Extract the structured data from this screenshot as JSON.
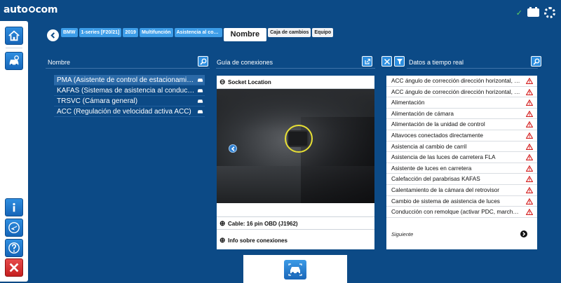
{
  "app": {
    "logo_left": "auto",
    "logo_right": "com"
  },
  "status": {
    "connected_icon": "check-icon",
    "battery_icon": "battery-icon",
    "settings_icon": "gear-icon"
  },
  "toolbar": {
    "top": [
      {
        "name": "home-icon"
      },
      {
        "name": "vehicle-settings-icon"
      }
    ],
    "bottom": [
      {
        "name": "info-icon"
      },
      {
        "name": "plane-icon"
      },
      {
        "name": "help-icon"
      },
      {
        "name": "close-icon"
      }
    ]
  },
  "breadcrumbs": [
    "BMW",
    "1-series [F20/21]",
    "2019",
    "Multifunción",
    "Asistencia al conductor"
  ],
  "breadcrumb_active": "Nombre",
  "breadcrumb_after": [
    "Caja de cambios",
    "Equipo"
  ],
  "nombre": {
    "header": "Nombre",
    "items": [
      "PMA (Asistente de control de estacionamiento)",
      "KAFAS (Sistemas de asistencia al conductor con cámara)",
      "TRSVC (Cámara general)",
      "ACC (Regulación de velocidad activa ACC)"
    ]
  },
  "guia": {
    "header": "Guía de conexiones",
    "socket_title": "Socket Location",
    "cable_label": "Cable: 16 pin OBD (J1962)",
    "info_label": "Info sobre conexiones",
    "collapse_symbol": "⊖",
    "expand_symbol": "⊕"
  },
  "datos": {
    "header": "Datos a tiempo real",
    "items": [
      "ACC ángulo de corrección dirección horizontal, cámara",
      "ACC ángulo de corrección dirección horizontal, radar",
      "Alimentación",
      "Alimentación de cámara",
      "Alimentación de la unidad de control",
      "Altavoces conectados directamente",
      "Asistencia al cambio de carril",
      "Asistencia de las luces de carretera FLA",
      "Asistente de luces en carretera",
      "Calefacción del parabrisas KAFAS",
      "Calentamiento de la cámara del retrovisor",
      "Cambio de sistema de asistencia de luces",
      "Conducción con remolque (activar PDC, marcha atrás)"
    ],
    "next_label": "Siguiente"
  },
  "colors": {
    "background": "#0c4a86",
    "accent": "#2e8fe0",
    "warning": "#d42020",
    "highlight_circle": "#e8e034"
  }
}
